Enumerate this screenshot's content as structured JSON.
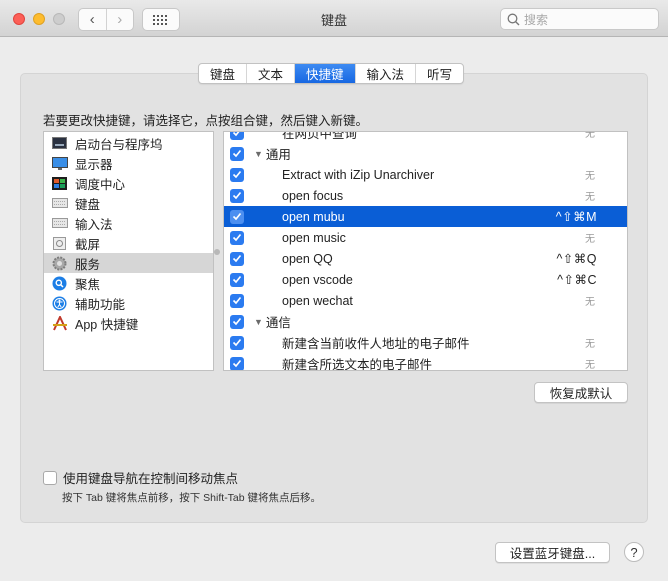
{
  "window": {
    "title": "键盘",
    "search_placeholder": "搜索",
    "nav_back": "‹",
    "nav_forward": "›"
  },
  "tabs": [
    {
      "label": "键盘",
      "active": false
    },
    {
      "label": "文本",
      "active": false
    },
    {
      "label": "快捷键",
      "active": true
    },
    {
      "label": "输入法",
      "active": false
    },
    {
      "label": "听写",
      "active": false
    }
  ],
  "instruction": "若要更改快捷键，请选择它，点按组合键，然后键入新键。",
  "categories": [
    {
      "label": "启动台与程序坞",
      "icon": "launchpad-dock-icon",
      "selected": false
    },
    {
      "label": "显示器",
      "icon": "display-icon",
      "selected": false
    },
    {
      "label": "调度中心",
      "icon": "mission-control-icon",
      "selected": false
    },
    {
      "label": "键盘",
      "icon": "keyboard-icon",
      "selected": false
    },
    {
      "label": "输入法",
      "icon": "input-method-icon",
      "selected": false
    },
    {
      "label": "截屏",
      "icon": "screenshot-icon",
      "selected": false
    },
    {
      "label": "服务",
      "icon": "gear-icon",
      "selected": true
    },
    {
      "label": "聚焦",
      "icon": "spotlight-icon",
      "selected": false
    },
    {
      "label": "辅助功能",
      "icon": "accessibility-icon",
      "selected": false
    },
    {
      "label": "App 快捷键",
      "icon": "app-shortcuts-icon",
      "selected": false
    }
  ],
  "services": [
    {
      "type": "item",
      "label": "在网页中查询",
      "shortcut": "无",
      "checked": true,
      "selected": false,
      "partial": true
    },
    {
      "type": "group",
      "label": "通用",
      "checked": true
    },
    {
      "type": "item",
      "label": "Extract with iZip Unarchiver",
      "shortcut": "无",
      "checked": true,
      "selected": false
    },
    {
      "type": "item",
      "label": "open focus",
      "shortcut": "无",
      "checked": true,
      "selected": false
    },
    {
      "type": "item",
      "label": "open mubu",
      "shortcut": "^⇧⌘M",
      "checked": true,
      "selected": true
    },
    {
      "type": "item",
      "label": "open music",
      "shortcut": "无",
      "checked": true,
      "selected": false
    },
    {
      "type": "item",
      "label": "open QQ",
      "shortcut": "^⇧⌘Q",
      "checked": true,
      "selected": false
    },
    {
      "type": "item",
      "label": "open vscode",
      "shortcut": "^⇧⌘C",
      "checked": true,
      "selected": false
    },
    {
      "type": "item",
      "label": "open wechat",
      "shortcut": "无",
      "checked": true,
      "selected": false
    },
    {
      "type": "group",
      "label": "通信",
      "checked": true
    },
    {
      "type": "item",
      "label": "新建含当前收件人地址的电子邮件",
      "shortcut": "无",
      "checked": true,
      "selected": false
    },
    {
      "type": "item",
      "label": "新建含所选文本的电子邮件",
      "shortcut": "无",
      "checked": true,
      "selected": false
    }
  ],
  "buttons": {
    "restore_defaults": "恢复成默认",
    "bluetooth_keyboard": "设置蓝牙键盘...",
    "help": "?"
  },
  "keyboard_navigation": {
    "label": "使用键盘导航在控制间移动焦点",
    "checked": false,
    "hint": "按下 Tab 键将焦点前移，按下 Shift-Tab 键将焦点后移。"
  }
}
